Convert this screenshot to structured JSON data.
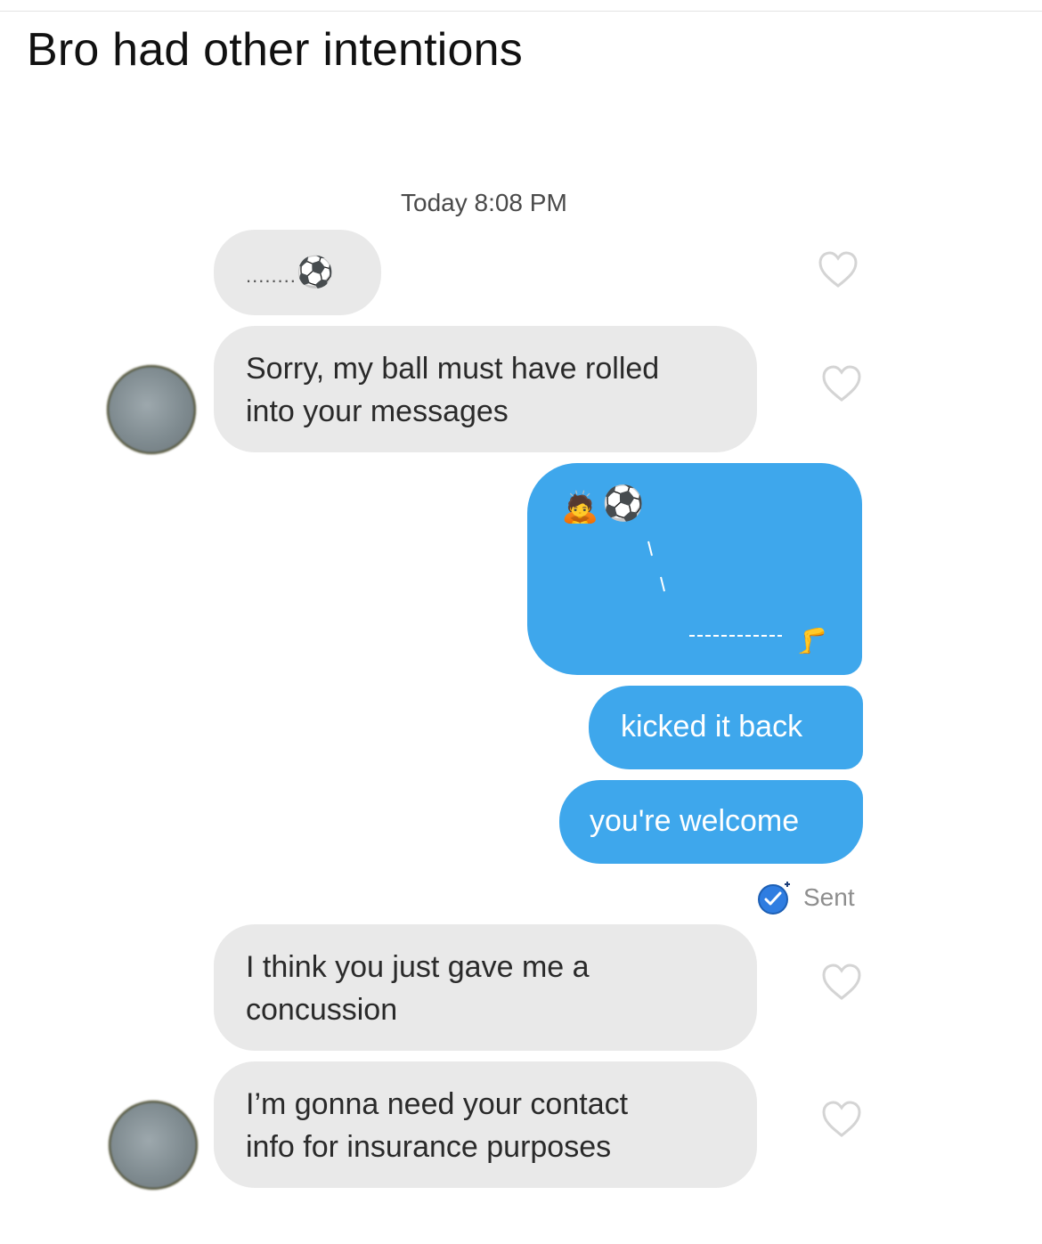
{
  "post": {
    "caption": "Bro had other intentions"
  },
  "chat": {
    "timestamp": "Today 8:08 PM",
    "messages": [
      {
        "side": "in",
        "text": "........",
        "emoji": "⚽"
      },
      {
        "side": "in",
        "text_line1": "Sorry, my ball must have rolled",
        "text_line2": "into your messages"
      },
      {
        "side": "out",
        "type": "emoji-drawing",
        "emoji_person": "🙇",
        "emoji_ball": "⚽",
        "emoji_leg": "🦵"
      },
      {
        "side": "out",
        "text": "kicked it back"
      },
      {
        "side": "out",
        "text": "you're welcome"
      },
      {
        "side": "in",
        "text_line1": "I think you just gave me a",
        "text_line2": "concussion"
      },
      {
        "side": "in",
        "text_line1": "I’m gonna need your contact",
        "text_line2": "info for insurance purposes"
      }
    ],
    "status": "Sent"
  },
  "colors": {
    "incoming_bubble": "#e9e9e9",
    "outgoing_bubble": "#3ea7ec",
    "sent_check": "#2f7de1"
  },
  "icons": {
    "like": "heart-outline-icon",
    "sent": "check-badge-icon"
  }
}
